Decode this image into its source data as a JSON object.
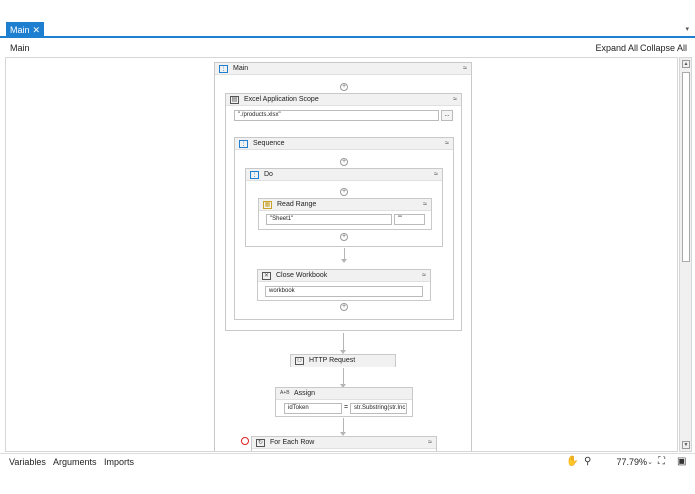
{
  "tabs": [
    {
      "label": "Main",
      "close": "✕"
    }
  ],
  "tab_menu": "▾",
  "header": {
    "breadcrumb": "Main",
    "expand_all": "Expand All",
    "collapse_all": "Collapse All"
  },
  "activities": {
    "main": {
      "title": "Main",
      "chev": "≈"
    },
    "excel_scope": {
      "title": "Excel Application Scope",
      "path": "\"./products.xlsx\"",
      "browse": "...",
      "chev": "≈"
    },
    "sequence": {
      "title": "Sequence",
      "chev": "≈"
    },
    "do": {
      "title": "Do",
      "chev": "≈"
    },
    "read_range": {
      "title": "Read Range",
      "sheet": "\"Sheet1\"",
      "range": "\"\"",
      "chev": "≈"
    },
    "close_workbook": {
      "title": "Close Workbook",
      "workbook": "workbook",
      "chev": "≈"
    },
    "http_request": {
      "title": "HTTP Request"
    },
    "assign": {
      "title": "Assign",
      "to": "idToken",
      "eq": "=",
      "value": "str.Substring(str.Inc"
    },
    "for_each_row": {
      "title": "For Each Row",
      "chev": "≈"
    }
  },
  "plus": "+",
  "bottom": {
    "variables": "Variables",
    "arguments": "Arguments",
    "imports": "Imports",
    "zoom": "77.79%",
    "zoom_chev": "⌄"
  },
  "icons": {
    "hand": "hand-pan-icon",
    "search": "search-icon",
    "fit": "fit-screen-icon",
    "overview": "overview-icon"
  }
}
